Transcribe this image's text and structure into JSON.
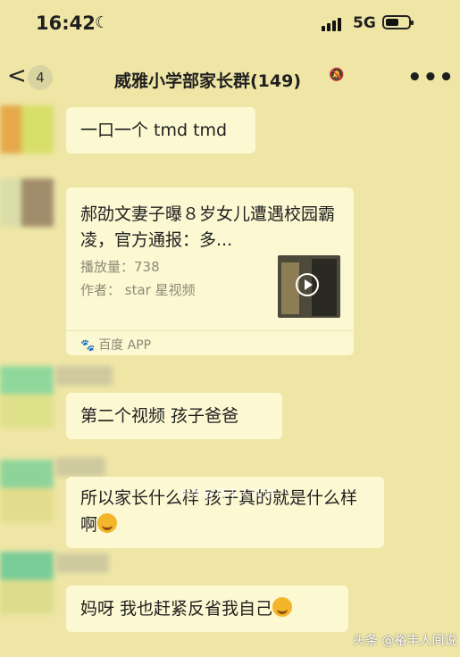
{
  "status": {
    "time": "16:42",
    "network": "5G",
    "battery_level": 0.55
  },
  "nav": {
    "unread": "4",
    "title": "威雅小学部家长群(149)"
  },
  "messages": {
    "m1": "一口一个 tmd tmd",
    "card": {
      "title": "郝劭文妻子曝８岁女儿遭遇校园霸凌，官方通报：多...",
      "plays": "播放量：738",
      "author": "作者：  star 星视频",
      "source": "百度 APP"
    },
    "m3": "第二个视频 孩子爸爸",
    "m4": "所以家长什么样 孩子真的就是什么样啊",
    "m5": "妈呀 我也赶紧反省我自己"
  },
  "watermark": "头条@裕丰人间说",
  "footer": "头条 @裕丰人间说",
  "colors": {
    "background": "#efe6a6",
    "bubble": "#fbf8d2",
    "accent": "#3a70c8"
  }
}
